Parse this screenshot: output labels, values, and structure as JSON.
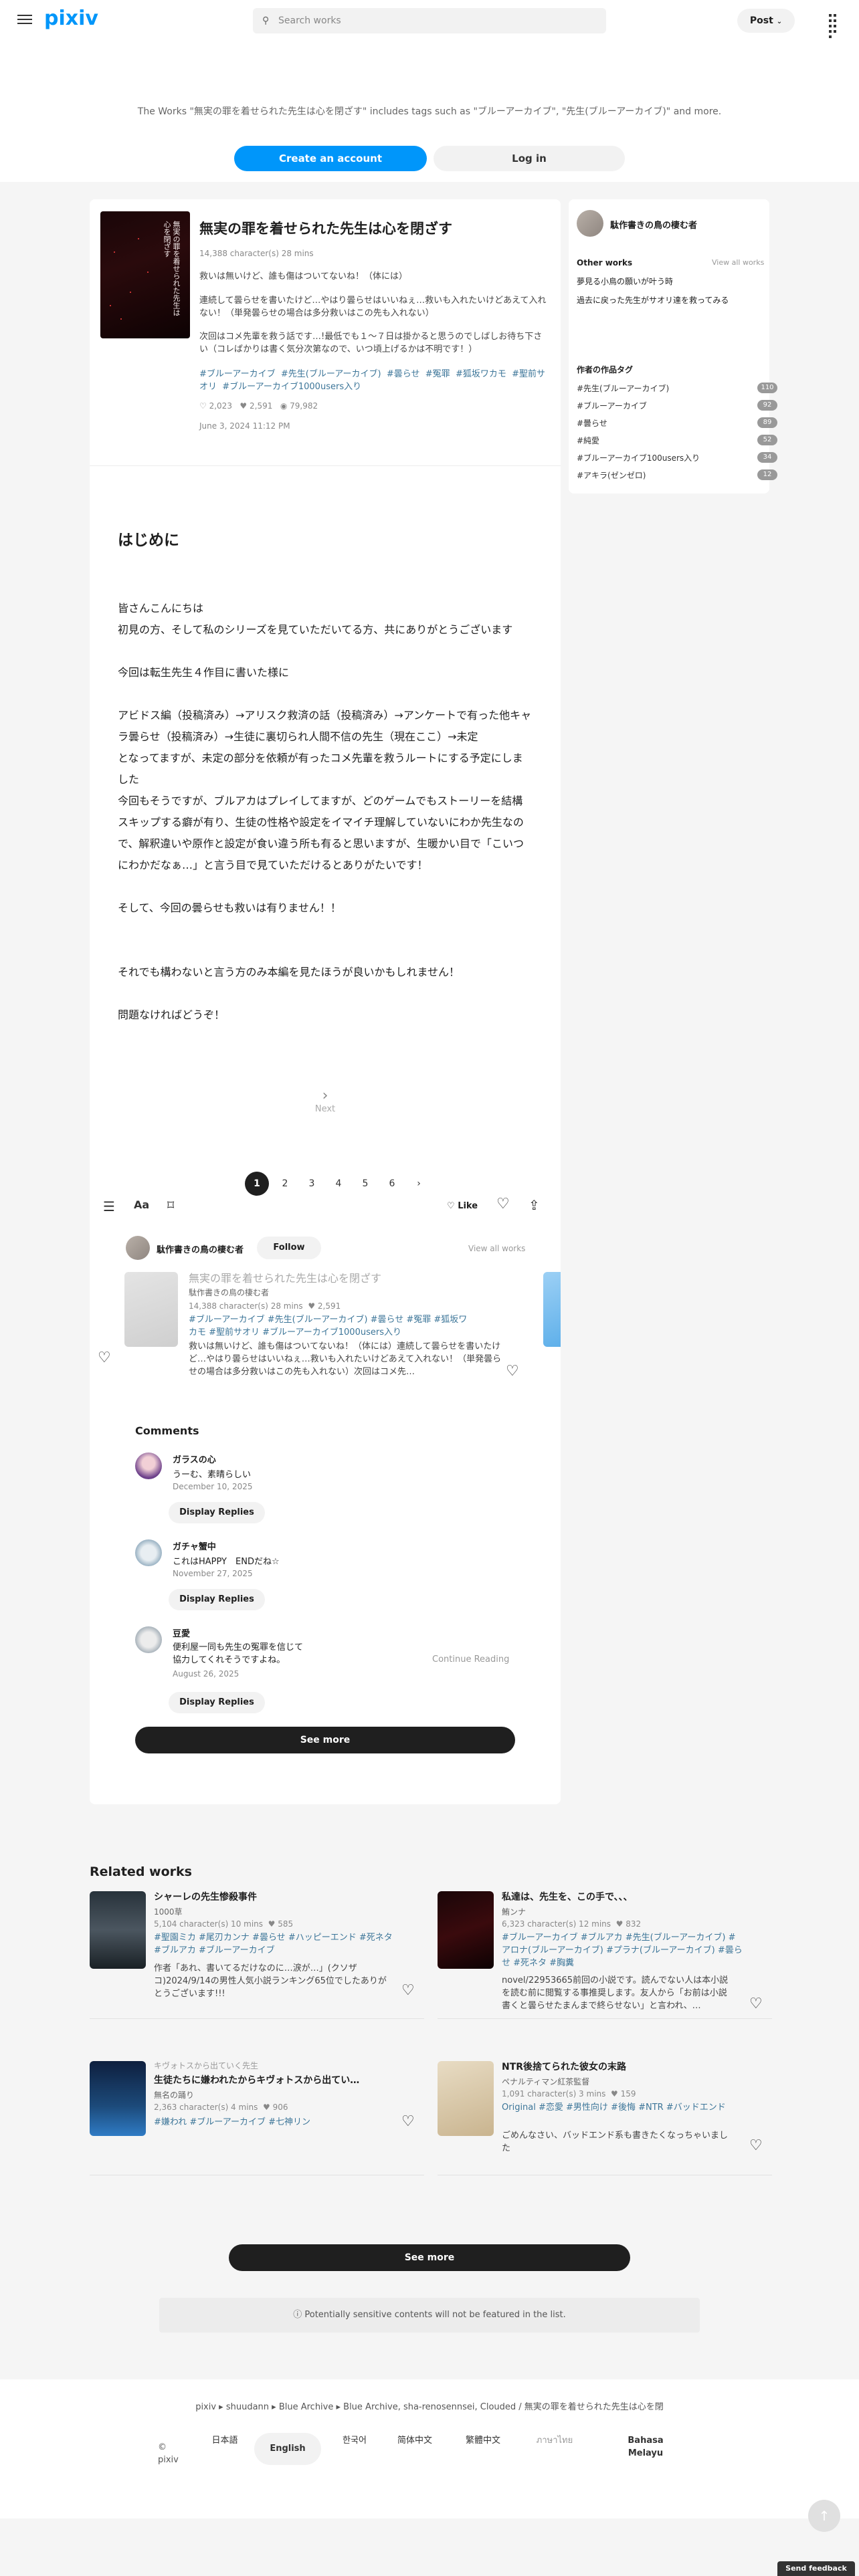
{
  "header": {
    "logo": "pixiv",
    "search_placeholder": "Search works",
    "post_label": "Post"
  },
  "banner": {
    "text": "The Works \"無実の罪を着せられた先生は心を閉ざす\" includes tags such as \"ブルーアーカイブ\", \"先生(ブルーアーカイブ)\" and more.",
    "create_account": "Create an account",
    "login": "Log in"
  },
  "work": {
    "cover_text": "無実の罪を着せられた先生は心を閉ざす",
    "title": "無実の罪を着せられた先生は心を閉ざす",
    "meta": "14,388 character(s)  28 mins",
    "desc1": "救いは無いけど、誰も傷はついてないね！（体には）",
    "desc2": "連続して曇らせを書いたけど…やはり曇らせはいいねぇ…救いも入れたいけどあえて入れない！（単発曇らせの場合は多分救いはこの先も入れない）",
    "desc3": "次回はコメ先輩を救う話です…!最低でも１〜７日は掛かると思うのでしばしお待ち下さい（コレばかりは書く気分次第なので、いつ頃上げるかは不明です！）",
    "tags": [
      "#ブルーアーカイブ",
      "#先生(ブルーアーカイブ)",
      "#曇らせ",
      "#冤罪",
      "#狐坂ワカモ",
      "#聖前サオリ",
      "#ブルーアーカイブ1000users入り"
    ],
    "likes": "2,023",
    "bookmarks": "2,591",
    "views": "79,982",
    "date": "June 3, 2024 11:12 PM"
  },
  "body": {
    "heading": "はじめに",
    "lines": [
      "皆さんこんにちは",
      "初見の方、そして私のシリーズを見ていただいてる方、共にありがとうございます",
      "今回は転生先生４作目に書いた様に",
      "アビドス編（投稿済み）→アリスク救済の話（投稿済み）→アンケートで有った他キャラ曇らせ（投稿済み）→生徒に裏切られ人間不信の先生（現在ここ）→未定",
      "となってますが、未定の部分を依頼が有ったコメ先輩を救うルートにする予定にしました",
      "今回もそうですが、ブルアカはプレイしてますが、どのゲームでもストーリーを結構スキップする癖が有り、生徒の性格や設定をイマイチ理解していないにわか先生なので、解釈違いや原作と設定が食い違う所も有ると思いますが、生暖かい目で「こいつにわかだなぁ…」と言う目で見ていただけるとありがたいです！",
      "そして、今回の曇らせも救いは有りません！！",
      "それでも構わないと言う方のみ本編を見たほうが良いかもしれません！",
      "問題なければどうぞ！"
    ],
    "next": "Next"
  },
  "pagination": [
    "1",
    "2",
    "3",
    "4",
    "5",
    "6"
  ],
  "toolbar": {
    "like": "Like"
  },
  "author": {
    "name": "駄作書きの鳥の棲む者",
    "follow": "Follow",
    "view_all": "View all works"
  },
  "series_item": {
    "title": "無実の罪を着せられた先生は心を閉ざす",
    "author": "駄作書きの鳥の棲む者",
    "meta": "14,388 character(s)  28 mins",
    "bookmarks": "2,591",
    "tags_line1": "#ブルーアーカイブ  #先生(ブルーアーカイブ)  #曇らせ  #冤罪  #狐坂ワ",
    "tags_line2": "カモ  #聖前サオリ  #ブルーアーカイブ1000users入り",
    "desc": "救いは無いけど、誰も傷はついてないね！（体には）連続して曇らせを書いたけど…やはり曇らせはいいねぇ…救いも入れたいけどあえて入れない！（単発曇らせの場合は多分救いはこの先も入れない）次回はコメ先…"
  },
  "comments": {
    "heading": "Comments",
    "items": [
      {
        "user": "ガラスの心",
        "text": "うーむ、素晴らしい",
        "date": "December 10, 2025",
        "replies": "Display Replies"
      },
      {
        "user": "ガチャ蟹中",
        "text": "これはHAPPY　ENDだね☆",
        "date": "November 27, 2025",
        "replies": "Display Replies"
      },
      {
        "user": "豆愛",
        "text": "便利屋一同も先生の冤罪を信じて\n協力してくれそうですよね。",
        "date": "August 26, 2025",
        "replies": "Display Replies",
        "continue": "Continue Reading"
      }
    ],
    "see_more": "See more"
  },
  "sidebar": {
    "author_name": "駄作書きの鳥の棲む者",
    "other_works": "Other works",
    "view_all": "View all works",
    "works": [
      "夢見る小鳥の願いが叶う時",
      "過去に戻った先生がサオリ達を救ってみる"
    ],
    "tags_heading": "作者の作品タグ",
    "tag_list": [
      {
        "name": "#先生(ブルーアーカイブ)",
        "count": "110"
      },
      {
        "name": "#ブルーアーカイブ",
        "count": "92"
      },
      {
        "name": "#曇らせ",
        "count": "89"
      },
      {
        "name": "#純愛",
        "count": "52"
      },
      {
        "name": "#ブルーアーカイブ100users入り",
        "count": "34"
      },
      {
        "name": "#アキラ(ゼンゼロ)",
        "count": "12"
      }
    ]
  },
  "related": {
    "heading": "Related works",
    "items": [
      {
        "title": "シャーレの先生惨殺事件",
        "author": "1000草",
        "meta": "5,104 character(s)  10 mins",
        "bookmarks": "585",
        "tags": "#聖園ミカ  #尾刃カンナ  #曇らせ  #ハッピーエンド  #死ネタ  #ブルアカ  #ブルーアーカイブ",
        "desc": "作者「あれ、書いてるだけなのに…涙が…」(クソザコ)2024/9/14の男性人気小説ランキング65位でしたありがとうございます!!!"
      },
      {
        "title": "私達は、先生を、この手で、、、",
        "author": "鮪ンナ",
        "meta": "6,323 character(s)  12 mins",
        "bookmarks": "832",
        "tags": "#ブルーアーカイブ  #ブルアカ  #先生(ブルーアーカイブ)  #アロナ(ブルーアーカイブ)  #プラナ(ブルーアーカイブ)  #曇らせ  #死ネタ  #胸糞",
        "desc": "novel/22953665前回の小説です。読んでない人は本小説を読む前に閲覧する事推奨します。友人から「お前は小説書くと曇らせたまんまで終らせない」と言われ、…"
      },
      {
        "title": "生徒たちに嫌われたからキヴォトスから出てい…",
        "prefix": "キヴォトスから出ていく先生",
        "author": "無名の踊り",
        "meta": "2,363 character(s)  4 mins",
        "bookmarks": "906",
        "tags": "#嫌われ  #ブルーアーカイブ  #七神リン"
      },
      {
        "title": "NTR後捨てられた彼女の末路",
        "author": "ペナルティマン紅茶監督",
        "meta": "1,091 character(s)  3 mins",
        "bookmarks": "159",
        "tags": "Original  #恋愛  #男性向け  #後悔  #NTR  #バッドエンド",
        "desc": "ごめんなさい、バッドエンド系も書きたくなっちゃいました"
      }
    ],
    "see_more": "See more",
    "notice": "Potentially sensitive contents will not be featured in the list."
  },
  "footer": {
    "breadcrumb": "pixiv  ▸  shuudann  ▸  Blue Archive  ▸  Blue Archive, sha-renosennsei, Clouded / 無実の罪を着せられた先生は心を閉",
    "copyright": "© pixiv",
    "languages": [
      "日本語",
      "English",
      "한국어",
      "简体中文",
      "繁體中文",
      "ภาษาไทย",
      "Bahasa Melayu"
    ],
    "feedback": "Send feedback"
  }
}
